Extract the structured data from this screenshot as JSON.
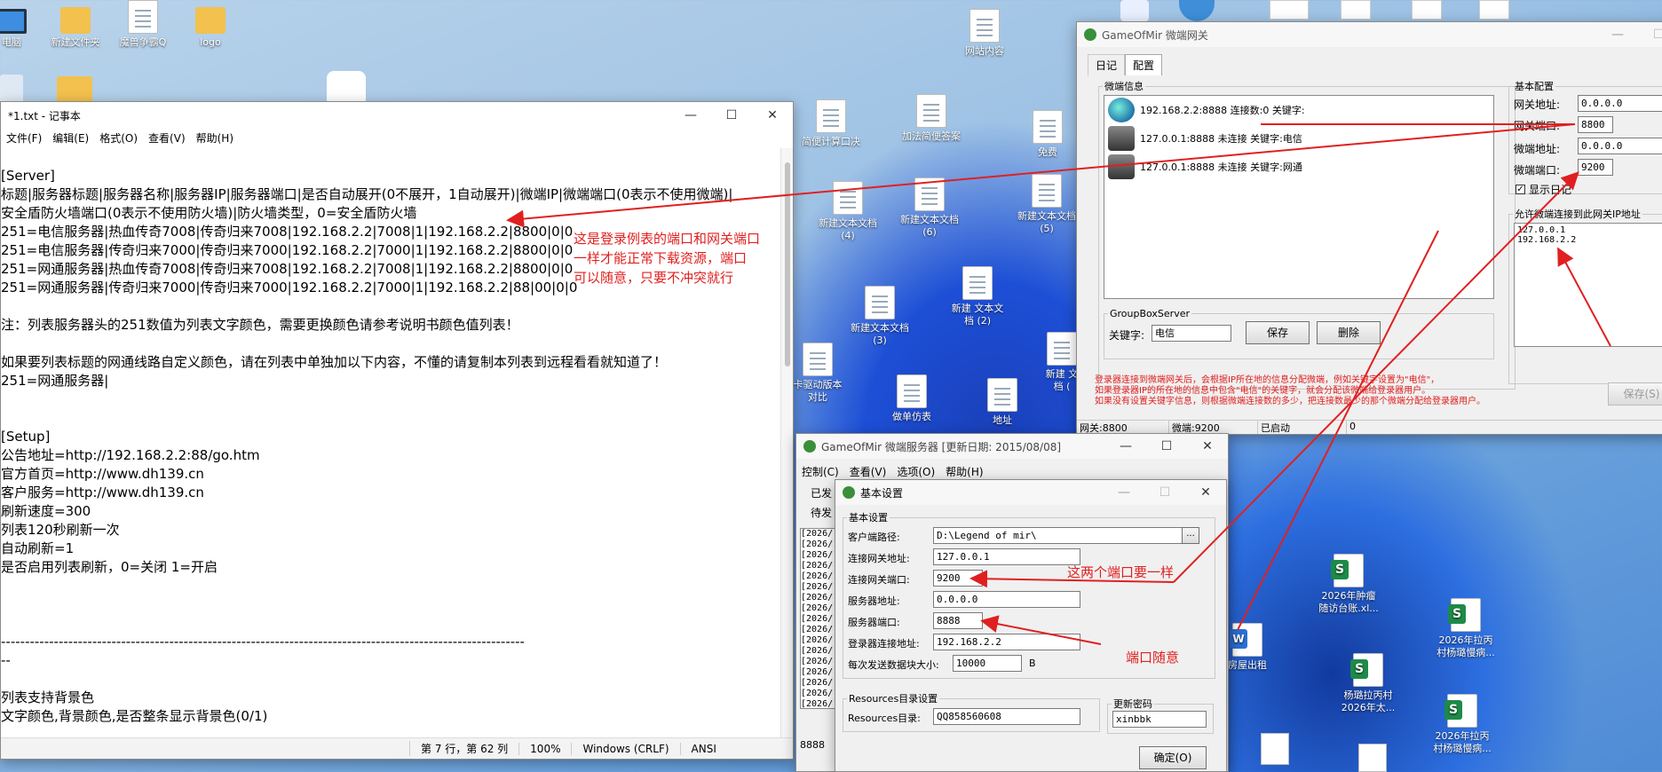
{
  "desktop": {
    "icons_top": [
      "电脑",
      "新建文件夹",
      "魔兽争霸Q",
      "logo"
    ],
    "icons": {
      "i1": "网站内容",
      "i2": "简便计算口决",
      "i3": "加法简便答案",
      "i4": "免费",
      "i5": "新建文本文档\n(4)",
      "i6": "新建文本文档\n(6)",
      "i7": "新建文本文档\n(5)",
      "i8": "新建文本文档\n(3)",
      "i9": "新建 文本文\n档 (2)",
      "i10": "卡驱动版本\n对比",
      "i11": "做单仿表",
      "i12": "地址",
      "i13": "新建 文\n档 (",
      "i14": "2026年肿瘤\n随访台账.xl...",
      "i15": "2026年拉丙\n村杨璐慢病...",
      "i16": "房屋出租",
      "i17": "杨璐拉丙村\n2026年太...",
      "i18": "2026年拉丙\n村杨璐慢病..."
    }
  },
  "notepad": {
    "title": "*1.txt - 记事本",
    "menu": [
      "文件(F)",
      "编辑(E)",
      "格式(O)",
      "查看(V)",
      "帮助(H)"
    ],
    "lines": [
      "",
      "[Server]",
      "标题|服务器标题|服务器名称|服务器IP|服务器端口|是否自动展开(0不展开，1自动展开)|微端IP|微端端口(0表示不使用微端)|",
      "安全盾防火墙端口(0表示不使用防火墙)|防火墙类型，0=安全盾防火墙",
      "251=电信服务器|热血传奇7008|传奇归来7008|192.168.2.2|7008|1|192.168.2.2|8800|0|0",
      "251=电信服务器|传奇归来7000|传奇归来7000|192.168.2.2|7000|1|192.168.2.2|8800|0|0",
      "251=网通服务器|热血传奇7008|传奇归来7008|192.168.2.2|7008|1|192.168.2.2|8800|0|0",
      "251=网通服务器|传奇归来7000|传奇归来7000|192.168.2.2|7000|1|192.168.2.2|88|00|0|0",
      "",
      "注：列表服务器头的251数值为列表文字颜色，需要更换颜色请参考说明书颜色值列表！",
      "",
      "如果要列表标题的网通线路自定义颜色，请在列表中单独加以下内容，不懂的请复制本列表到远程看看就知道了！",
      "251=网通服务器|",
      "",
      "",
      "[Setup]",
      "公告地址=http://192.168.2.2:88/go.htm",
      "官方首页=http://www.dh139.cn",
      "客户服务=http://www.dh139.cn",
      "刷新速度=300",
      "列表120秒刷新一次",
      "自动刷新=1",
      "是否启用列表刷新，0=关闭 1=开启",
      "",
      "",
      "",
      "-------------------------------------------------------------------------------------------------------------",
      "--",
      "",
      "列表支持背景色",
      "文字颜色,背景颜色,是否整条显示背景色(0/1)"
    ],
    "status": {
      "position": "第 7 行，第 62 列",
      "zoom": "100%",
      "eol": "Windows (CRLF)",
      "encoding": "ANSI"
    }
  },
  "annotations": {
    "note1": "这是登录例表的端口和网关端口\n一样才能正常下载资源，端口\n可以随意，只要不冲突就行",
    "note2": "这两个端口要一样",
    "note3": "端口随意"
  },
  "gateway": {
    "title": "GameOfMir 微端网关",
    "tabs": [
      "日记",
      "配置"
    ],
    "info_group": "微端信息",
    "list": [
      "192.168.2.2:8888 连接数:0 关键字:",
      "127.0.0.1:8888 未连接 关键字:电信",
      "127.0.0.1:8888 未连接 关键字:网通"
    ],
    "group_server": "GroupBoxServer",
    "keyword_label": "关键字:",
    "keyword_value": "电信",
    "save": "保存",
    "delete": "删除",
    "basic_group": "基本配置",
    "gw_addr_label": "网关地址:",
    "gw_addr": "0.0.0.0",
    "gw_port_label": "网关端口:",
    "gw_port": "8800",
    "mc_addr_label": "微端地址:",
    "mc_addr": "0.0.0.0",
    "mc_port_label": "微端端口:",
    "mc_port": "9200",
    "show_log": "显示日记",
    "allow_group": "允许微端连接到此网关IP地址",
    "allow_ips": "127.0.0.1\n192.168.2.2",
    "desc1": "登录器连接到微端网关后，会根据IP所在地的信息分配微端，例如关键字设置为\"电信\"，",
    "desc2": "如果登录器IP的所在地的信息中包含\"电信\"的关键字，就会分配该微端给登录器用户。",
    "desc3": "如果没有设置关键字信息，则根据微端连接数的多少，把连接数最少的那个微端分配给登录器用户。",
    "save2": "保存(S)",
    "status": [
      "网关:8800",
      "微端:9200",
      "已启动",
      "0"
    ]
  },
  "server": {
    "title": "GameOfMir 微端服务器 [更新日期: 2015/08/08]",
    "menu": [
      "控制(C)",
      "查看(V)",
      "选项(O)",
      "帮助(H)"
    ],
    "side": [
      "已发",
      "待发"
    ],
    "log_lines": [
      "[2026/",
      "[2026/",
      "[2026/",
      "[2026/",
      "[2026/",
      "[2026/",
      "[2026/",
      "[2026/",
      "[2026/",
      "[2026/",
      "[2026/",
      "[2026/",
      "[2026/",
      "[2026/",
      "[2026/",
      "[2026/",
      "[2026/"
    ],
    "bottom": "8888"
  },
  "settings": {
    "title": "基本设置",
    "group": "基本设置",
    "client_path_label": "客户端路径:",
    "client_path": "D:\\Legend of mir\\",
    "browse": "...",
    "gw_addr_label": "连接网关地址:",
    "gw_addr": "127.0.0.1",
    "gw_port_label": "连接网关端口:",
    "gw_port": "9200",
    "srv_addr_label": "服务器地址:",
    "srv_addr": "0.0.0.0",
    "srv_port_label": "服务器端口:",
    "srv_port": "8888",
    "login_addr_label": "登录器连接地址:",
    "login_addr": "192.168.2.2",
    "block_label": "每次发送数据块大小:",
    "block_value": "10000",
    "block_unit": "B",
    "res_group": "Resources目录设置",
    "res_label": "Resources目录:",
    "res_value": "QQ858560608",
    "pwd_group": "更新密码",
    "pwd_value": "xinbbk",
    "ok": "确定(O)"
  }
}
